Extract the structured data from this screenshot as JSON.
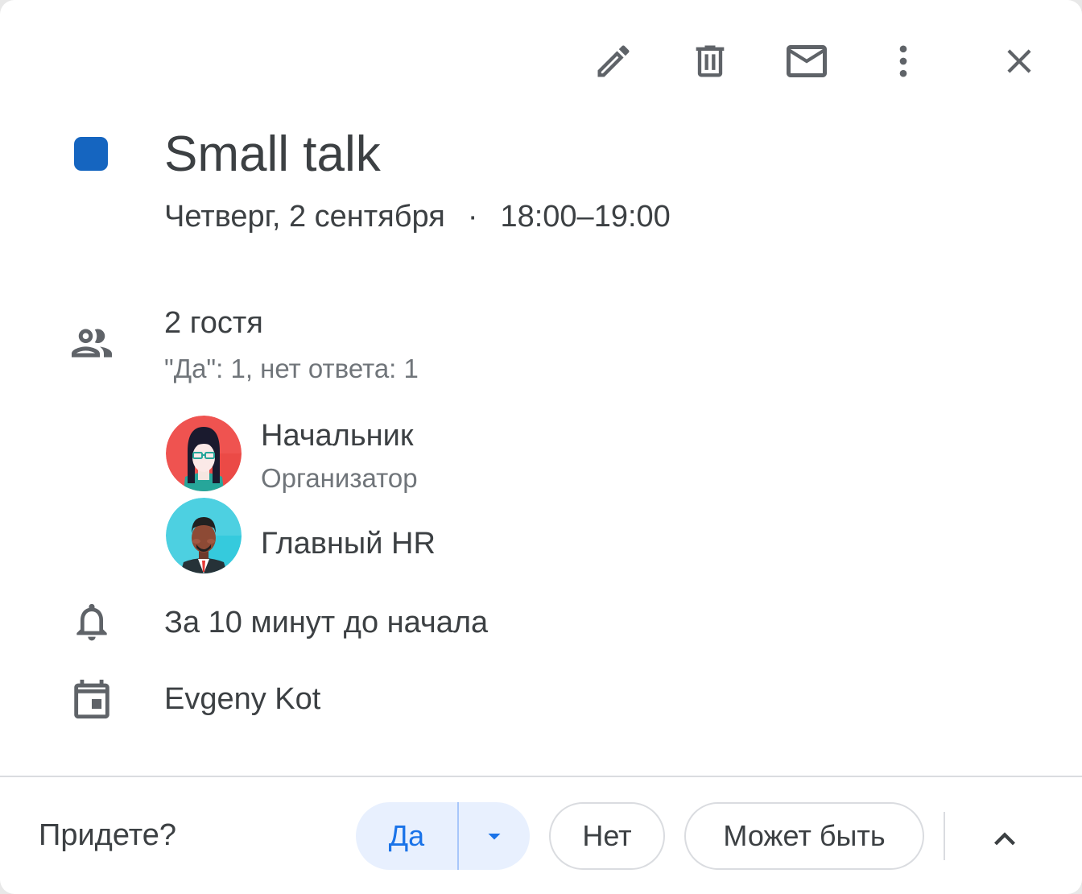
{
  "colors": {
    "event_color": "#1565c0",
    "icon_gray": "#5f6368",
    "accent_blue": "#1a73e8"
  },
  "toolbar": {
    "edit_icon": "pencil-icon",
    "delete_icon": "trash-icon",
    "email_icon": "envelope-icon",
    "more_icon": "more-vertical-icon",
    "close_icon": "close-icon"
  },
  "event": {
    "title": "Small talk",
    "date": "Четверг, 2 сентября",
    "separator": "·",
    "time": "18:00–19:00"
  },
  "guests": {
    "count_label": "2 гостя",
    "summary": "\"Да\": 1, нет ответа: 1",
    "list": [
      {
        "name": "Начальник",
        "role": "Организатор"
      },
      {
        "name": "Главный HR",
        "role": ""
      }
    ]
  },
  "reminder": {
    "label": "За 10 минут до начала"
  },
  "calendar": {
    "owner": "Evgeny Kot"
  },
  "rsvp": {
    "question": "Придете?",
    "yes": "Да",
    "no": "Нет",
    "maybe": "Может быть"
  }
}
